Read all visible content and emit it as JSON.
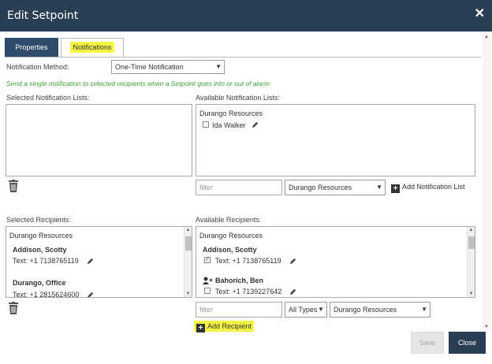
{
  "dialog": {
    "title": "Edit Setpoint",
    "close_glyph": "✕"
  },
  "tabs": [
    {
      "label": "Properties",
      "active": false
    },
    {
      "label": "Notifications",
      "active": true
    }
  ],
  "notification": {
    "method_label": "Notification Method:",
    "method_value": "One-Time Notification",
    "description": "Send a single notification to selected recipients when a Setpoint goes into or out of alarm"
  },
  "selected_lists": {
    "label": "Selected Notification Lists:"
  },
  "available_lists": {
    "label": "Available Notification Lists:",
    "group": "Durango Resources",
    "items": [
      {
        "name": "Ida Walker",
        "checked": false
      }
    ],
    "filter_placeholder": "filter",
    "org_select": "Durango Resources",
    "add_label": "Add Notification List"
  },
  "selected_recipients": {
    "label": "Selected Recipients:",
    "group": "Durango Resources",
    "items": [
      {
        "name": "Addison, Scotty",
        "text": "Text: +1 7138765119"
      },
      {
        "name": "Durango, Office",
        "text": "Text: +1 2815624600"
      }
    ]
  },
  "available_recipients": {
    "label": "Available Recipients:",
    "group": "Durango Resources",
    "items": [
      {
        "name": "Addison, Scotty",
        "text": "Text: +1 7138765119",
        "checked": true
      },
      {
        "name": "Bahorich, Ben",
        "text": "Text: +1 7139227642",
        "checked": false
      }
    ],
    "filter_placeholder": "filter",
    "type_select": "All Types",
    "org_select": "Durango Resources",
    "add_label": "Add Recipient"
  },
  "footer": {
    "save_label": "Save",
    "close_label": "Close"
  },
  "colors": {
    "header": "#2a3f54",
    "highlight": "#f5f543",
    "note": "#3aa53a"
  },
  "icons": [
    "close-icon",
    "trash-icon",
    "pencil-icon",
    "plus-icon",
    "user-icon",
    "chevron-down-icon"
  ]
}
